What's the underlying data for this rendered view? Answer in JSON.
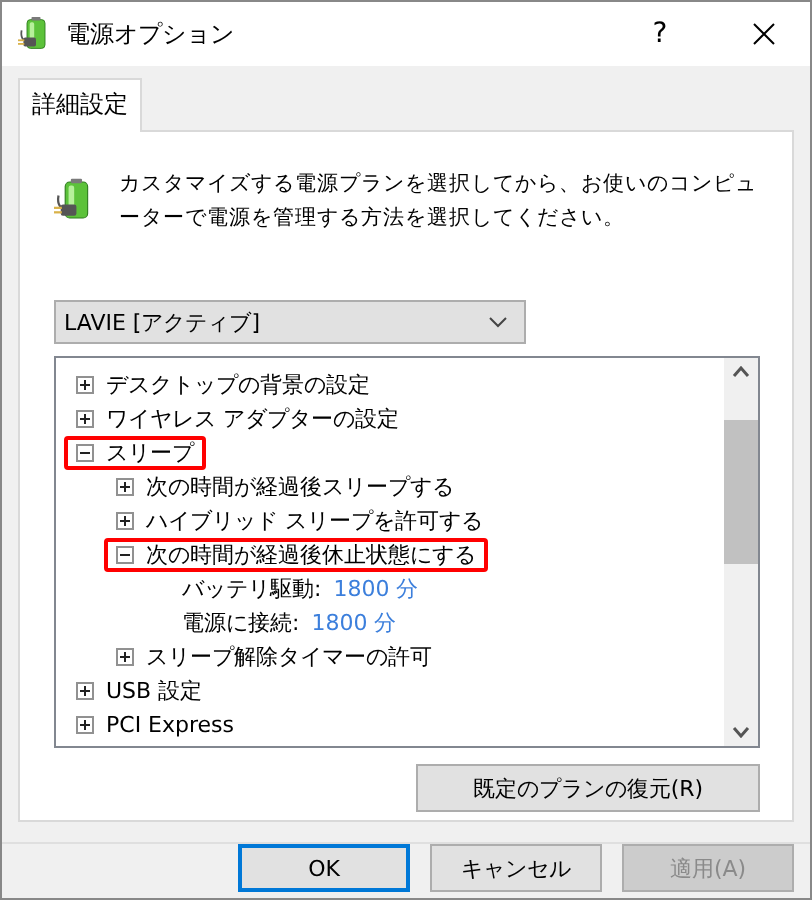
{
  "window": {
    "title": "電源オプション",
    "help": "?"
  },
  "tabs": [
    {
      "label": "詳細設定",
      "selected": true
    }
  ],
  "description": "カスタマイズする電源プランを選択してから、お使いのコンピューターで電源を管理する方法を選択してください。",
  "plan_dropdown": {
    "value": "LAVIE [アクティブ]"
  },
  "tree": [
    {
      "kind": "group",
      "label": "デスクトップの背景の設定",
      "expanded": false,
      "highlighted": false
    },
    {
      "kind": "group",
      "label": "ワイヤレス アダプターの設定",
      "expanded": false,
      "highlighted": false
    },
    {
      "kind": "group",
      "label": "スリープ",
      "expanded": true,
      "highlighted": true,
      "children": [
        {
          "kind": "group",
          "label": "次の時間が経過後スリープする",
          "expanded": false,
          "highlighted": false
        },
        {
          "kind": "group",
          "label": "ハイブリッド スリープを許可する",
          "expanded": false,
          "highlighted": false
        },
        {
          "kind": "group",
          "label": "次の時間が経過後休止状態にする",
          "expanded": true,
          "highlighted": true,
          "children": [
            {
              "kind": "setting",
              "label": "バッテリ駆動:",
              "value": "1800 分"
            },
            {
              "kind": "setting",
              "label": "電源に接続:",
              "value": "1800 分"
            }
          ]
        },
        {
          "kind": "group",
          "label": "スリープ解除タイマーの許可",
          "expanded": false,
          "highlighted": false
        }
      ]
    },
    {
      "kind": "group",
      "label": "USB 設定",
      "expanded": false,
      "highlighted": false
    },
    {
      "kind": "group",
      "label": "PCI Express",
      "expanded": false,
      "highlighted": false
    }
  ],
  "restore_button": "既定のプランの復元(R)",
  "buttons": [
    {
      "label": "OK",
      "default": true,
      "disabled": false
    },
    {
      "label": "キャンセル",
      "default": false,
      "disabled": false
    },
    {
      "label": "適用(A)",
      "default": false,
      "disabled": true
    }
  ]
}
